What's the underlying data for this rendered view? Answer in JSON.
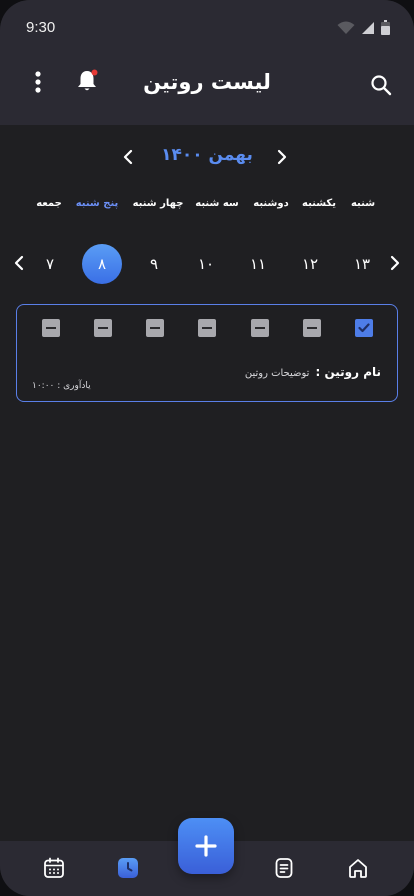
{
  "status": {
    "time": "9:30"
  },
  "header": {
    "title": "لیست روتین"
  },
  "calendar": {
    "month_label": "بهمن ۱۴۰۰",
    "weekdays": [
      "شنبه",
      "یکشنبه",
      "دوشنبه",
      "سه شنبه",
      "چهار شنبه",
      "پنج شنبه",
      "جمعه"
    ],
    "active_weekday_index": 5,
    "days": [
      "۱۳",
      "۱۲",
      "۱۱",
      "۱۰",
      "۹",
      "۸",
      "۷"
    ],
    "selected_day_index": 5
  },
  "routine": {
    "name_label": "نام روتین :",
    "description": "توضیحات روتین",
    "reminder": "یادآوری : ۱۰:۰۰",
    "checks": [
      "on",
      "dash",
      "dash",
      "dash",
      "dash",
      "dash",
      "dash"
    ]
  },
  "colors": {
    "accent": "#5a8cf0",
    "background": "#1f1f22",
    "bar": "#2b2a33",
    "badge": "#e53935"
  },
  "icons": {
    "header": [
      "kebab-menu-icon",
      "bell-icon",
      "search-icon"
    ],
    "nav": [
      "home-icon",
      "notes-icon",
      "clock-icon",
      "calendar-icon"
    ],
    "fab": "plus-icon"
  }
}
